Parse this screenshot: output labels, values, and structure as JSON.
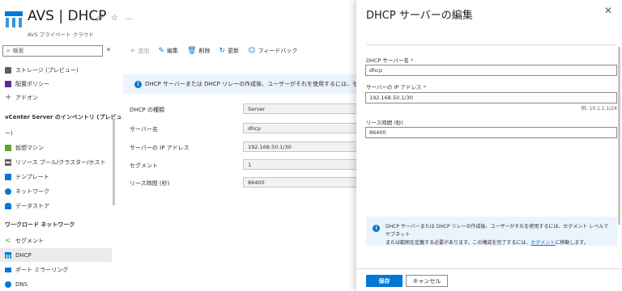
{
  "header": {
    "title": "AVS | DHCP",
    "subtitle": "AVS プライベート クラウド",
    "pin_icon": "pin-icon",
    "favorite_icon": "star-icon",
    "more": "..."
  },
  "sidebar": {
    "search_placeholder": "検索",
    "collapse_glyph": "«",
    "items_top": [
      {
        "label": "ストレージ (プレビュー)",
        "icon": "storage-icon",
        "color": "#605e5c"
      },
      {
        "label": "配置ポリシー",
        "icon": "placement-policy-icon",
        "color": "#5c2d91"
      },
      {
        "label": "アドオン",
        "icon": "plus-icon",
        "color": "#605e5c"
      }
    ],
    "section_inventory": "vCenter Server のインベントリ (プレビュ",
    "section_inventory_cont": "ー)",
    "items_inventory": [
      {
        "label": "仮想マシン",
        "icon": "virtual-machine-icon",
        "color": "#5ea722"
      },
      {
        "label": "リソース プール/クラスター/ホスト",
        "icon": "resource-pool-icon",
        "color": "#605e5c"
      },
      {
        "label": "テンプレート",
        "icon": "template-icon",
        "color": "#0078d4"
      },
      {
        "label": "ネットワーク",
        "icon": "network-icon",
        "color": "#0078d4"
      },
      {
        "label": "データストア",
        "icon": "datastore-icon",
        "color": "#0078d4"
      }
    ],
    "section_workload": "ワークロード ネットワーク",
    "items_workload": [
      {
        "label": "セグメント",
        "icon": "segment-icon",
        "color": "#5ea722"
      },
      {
        "label": "DHCP",
        "icon": "dhcp-icon",
        "color": "#0078d4",
        "active": true
      },
      {
        "label": "ポート ミラーリング",
        "icon": "port-mirroring-icon",
        "color": "#0078d4"
      },
      {
        "label": "DNS",
        "icon": "dns-icon",
        "color": "#0078d4"
      }
    ]
  },
  "toolbar": {
    "add": "追加",
    "edit": "編集",
    "delete": "削除",
    "refresh": "更新",
    "feedback": "フィードバック"
  },
  "info_bar": {
    "text": "DHCP サーバーまたは DHCP リレーの作成後、ユーザーがそれを使用するには、セグメント レベルでサ"
  },
  "properties": [
    {
      "label": "DHCP の種類",
      "value": "Server"
    },
    {
      "label": "サーバー名",
      "value": "dhcp"
    },
    {
      "label": "サーバーの IP アドレス",
      "value": "192.168.50.1/30"
    },
    {
      "label": "セグメント",
      "value": "1"
    },
    {
      "label": "リース時間 (秒)",
      "value": "86400"
    }
  ],
  "panel": {
    "title": "DHCP サーバーの編集",
    "close": "✕",
    "server_name_label": "DHCP サーバー名",
    "server_name_value": "dhcp",
    "server_ip_label": "サーバーの IP アドレス",
    "server_ip_value": "192.168.50.1/30",
    "server_ip_hint": "例: 10.1.1.1/24",
    "lease_label": "リース時間 (秒)",
    "lease_value": "86400",
    "required_mark": "*",
    "info_line1": "DHCP サーバーまたは DHCP リレーの作成後、ユーザーがそれを使用するには、セグメント レベルでサブネット",
    "info_line2_pre": "または範囲を定義する必要があります。この構成を完了するには、",
    "info_link": "セグメント",
    "info_line2_post": "に移動します。",
    "save": "保存",
    "cancel": "キャンセル"
  },
  "colors": {
    "accent": "#0078d4",
    "info_bg": "#ebf3fc"
  }
}
